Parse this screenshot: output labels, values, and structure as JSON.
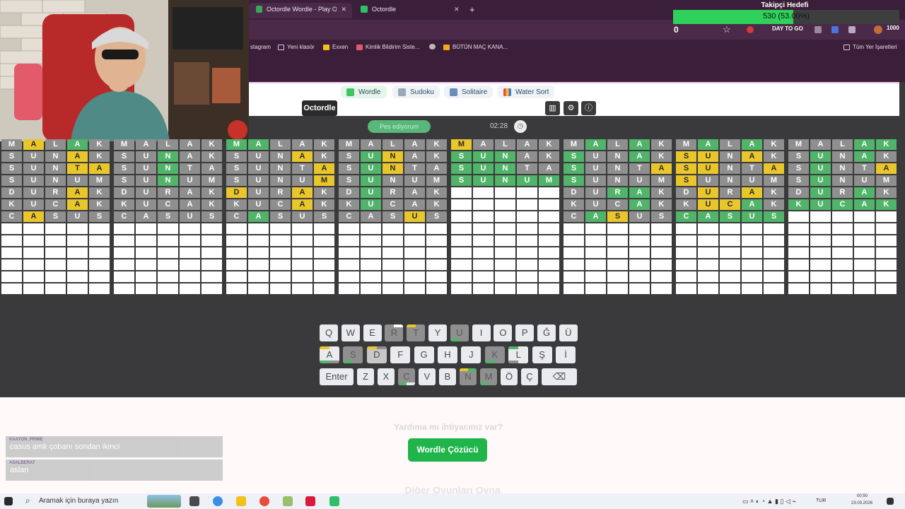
{
  "browser": {
    "tabs": [
      {
        "label": "Octordle Wordle - Play Octordl",
        "close": "✕"
      },
      {
        "label": "Octordle",
        "close": "✕"
      }
    ],
    "new_tab": "+",
    "bookmarks": [
      "stagram",
      "Yeni klasör",
      "Exxen",
      "Kimlik Bildirim Siste...",
      "BÜTÜN MAÇ KANA..."
    ],
    "all_bookmarks": "Tüm Yer İşaretleri"
  },
  "stream_overlay": {
    "title": "Takipçi Hedefi",
    "progress_text": "530 (53.00%)",
    "progress_fraction": 0.53,
    "left_value": "0",
    "right_value": "1000",
    "brand_text": "DAY TO GO"
  },
  "game_nav": [
    {
      "label": "Wordle"
    },
    {
      "label": "Sudoku"
    },
    {
      "label": "Solitaire"
    },
    {
      "label": "Water Sort"
    }
  ],
  "header": {
    "brand": "Octordle",
    "stats_icon": "stats-icon",
    "settings_icon": "gear-icon",
    "info_icon": "info-icon"
  },
  "status": {
    "give_up": "Pes ediyorum",
    "timer": "02:28"
  },
  "boards": [
    {
      "rows": [
        [
          "M",
          "A",
          "L",
          "A",
          "K"
        ],
        [
          "S",
          "U",
          "N",
          "A",
          "K"
        ],
        [
          "S",
          "U",
          "N",
          "T",
          "A"
        ],
        [
          "S",
          "U",
          "N",
          "U",
          "M"
        ],
        [
          "D",
          "U",
          "R",
          "A",
          "K"
        ],
        [
          "K",
          "U",
          "C",
          "A",
          "K"
        ],
        [
          "C",
          "A",
          "S",
          "U",
          "S"
        ]
      ],
      "states": [
        [
          "x",
          "y",
          "x",
          "g",
          "x"
        ],
        [
          "x",
          "x",
          "x",
          "y",
          "x"
        ],
        [
          "x",
          "x",
          "x",
          "y",
          "y"
        ],
        [
          "x",
          "x",
          "x",
          "x",
          "x"
        ],
        [
          "x",
          "x",
          "x",
          "y",
          "x"
        ],
        [
          "x",
          "x",
          "x",
          "y",
          "x"
        ],
        [
          "x",
          "y",
          "x",
          "x",
          "x"
        ]
      ]
    },
    {
      "rows": [
        [
          "M",
          "A",
          "L",
          "A",
          "K"
        ],
        [
          "S",
          "U",
          "N",
          "A",
          "K"
        ],
        [
          "S",
          "U",
          "N",
          "T",
          "A"
        ],
        [
          "S",
          "U",
          "N",
          "U",
          "M"
        ],
        [
          "D",
          "U",
          "R",
          "A",
          "K"
        ],
        [
          "K",
          "U",
          "C",
          "A",
          "K"
        ],
        [
          "C",
          "A",
          "S",
          "U",
          "S"
        ]
      ],
      "states": [
        [
          "x",
          "x",
          "x",
          "x",
          "x"
        ],
        [
          "x",
          "x",
          "g",
          "x",
          "x"
        ],
        [
          "x",
          "x",
          "g",
          "x",
          "x"
        ],
        [
          "x",
          "x",
          "g",
          "x",
          "x"
        ],
        [
          "x",
          "x",
          "x",
          "x",
          "x"
        ],
        [
          "x",
          "x",
          "x",
          "x",
          "x"
        ],
        [
          "x",
          "x",
          "x",
          "x",
          "x"
        ]
      ]
    },
    {
      "rows": [
        [
          "M",
          "A",
          "L",
          "A",
          "K"
        ],
        [
          "S",
          "U",
          "N",
          "A",
          "K"
        ],
        [
          "S",
          "U",
          "N",
          "T",
          "A"
        ],
        [
          "S",
          "U",
          "N",
          "U",
          "M"
        ],
        [
          "D",
          "U",
          "R",
          "A",
          "K"
        ],
        [
          "K",
          "U",
          "C",
          "A",
          "K"
        ],
        [
          "C",
          "A",
          "S",
          "U",
          "S"
        ]
      ],
      "states": [
        [
          "g",
          "g",
          "x",
          "x",
          "x"
        ],
        [
          "x",
          "x",
          "x",
          "y",
          "x"
        ],
        [
          "x",
          "x",
          "x",
          "x",
          "y"
        ],
        [
          "x",
          "x",
          "x",
          "x",
          "y"
        ],
        [
          "y",
          "x",
          "x",
          "y",
          "x"
        ],
        [
          "x",
          "x",
          "x",
          "y",
          "x"
        ],
        [
          "x",
          "g",
          "x",
          "x",
          "x"
        ]
      ]
    },
    {
      "rows": [
        [
          "M",
          "A",
          "L",
          "A",
          "K"
        ],
        [
          "S",
          "U",
          "N",
          "A",
          "K"
        ],
        [
          "S",
          "U",
          "N",
          "T",
          "A"
        ],
        [
          "S",
          "U",
          "N",
          "U",
          "M"
        ],
        [
          "D",
          "U",
          "R",
          "A",
          "K"
        ],
        [
          "K",
          "U",
          "C",
          "A",
          "K"
        ],
        [
          "C",
          "A",
          "S",
          "U",
          "S"
        ]
      ],
      "states": [
        [
          "x",
          "x",
          "x",
          "x",
          "x"
        ],
        [
          "x",
          "g",
          "y",
          "x",
          "x"
        ],
        [
          "x",
          "g",
          "y",
          "x",
          "x"
        ],
        [
          "x",
          "g",
          "x",
          "x",
          "x"
        ],
        [
          "x",
          "g",
          "x",
          "x",
          "x"
        ],
        [
          "x",
          "g",
          "x",
          "x",
          "x"
        ],
        [
          "x",
          "x",
          "x",
          "y",
          "x"
        ]
      ]
    },
    {
      "rows": [
        [
          "M",
          "A",
          "L",
          "A",
          "K"
        ],
        [
          "S",
          "U",
          "N",
          "A",
          "K"
        ],
        [
          "S",
          "U",
          "N",
          "T",
          "A"
        ],
        [
          "S",
          "U",
          "N",
          "U",
          "M"
        ]
      ],
      "states": [
        [
          "y",
          "x",
          "x",
          "x",
          "x"
        ],
        [
          "g",
          "g",
          "g",
          "x",
          "x"
        ],
        [
          "g",
          "g",
          "g",
          "x",
          "x"
        ],
        [
          "g",
          "g",
          "g",
          "g",
          "g"
        ]
      ]
    },
    {
      "rows": [
        [
          "M",
          "A",
          "L",
          "A",
          "K"
        ],
        [
          "S",
          "U",
          "N",
          "A",
          "K"
        ],
        [
          "S",
          "U",
          "N",
          "T",
          "A"
        ],
        [
          "S",
          "U",
          "N",
          "U",
          "M"
        ],
        [
          "D",
          "U",
          "R",
          "A",
          "K"
        ],
        [
          "K",
          "U",
          "C",
          "A",
          "K"
        ],
        [
          "C",
          "A",
          "S",
          "U",
          "S"
        ]
      ],
      "states": [
        [
          "x",
          "g",
          "x",
          "g",
          "x"
        ],
        [
          "g",
          "x",
          "x",
          "g",
          "x"
        ],
        [
          "g",
          "x",
          "x",
          "x",
          "y"
        ],
        [
          "g",
          "x",
          "x",
          "x",
          "x"
        ],
        [
          "x",
          "x",
          "g",
          "g",
          "x"
        ],
        [
          "x",
          "x",
          "x",
          "g",
          "x"
        ],
        [
          "x",
          "g",
          "y",
          "x",
          "x"
        ]
      ]
    },
    {
      "rows": [
        [
          "M",
          "A",
          "L",
          "A",
          "K"
        ],
        [
          "S",
          "U",
          "N",
          "A",
          "K"
        ],
        [
          "S",
          "U",
          "N",
          "T",
          "A"
        ],
        [
          "S",
          "U",
          "N",
          "U",
          "M"
        ],
        [
          "D",
          "U",
          "R",
          "A",
          "K"
        ],
        [
          "K",
          "U",
          "C",
          "A",
          "K"
        ],
        [
          "C",
          "A",
          "S",
          "U",
          "S"
        ]
      ],
      "states": [
        [
          "x",
          "g",
          "x",
          "g",
          "x"
        ],
        [
          "y",
          "y",
          "x",
          "y",
          "x"
        ],
        [
          "y",
          "y",
          "x",
          "x",
          "y"
        ],
        [
          "y",
          "x",
          "x",
          "x",
          "x"
        ],
        [
          "x",
          "y",
          "x",
          "y",
          "x"
        ],
        [
          "x",
          "y",
          "y",
          "g",
          "x"
        ],
        [
          "g",
          "g",
          "g",
          "g",
          "g"
        ]
      ]
    },
    {
      "rows": [
        [
          "M",
          "A",
          "L",
          "A",
          "K"
        ],
        [
          "S",
          "U",
          "N",
          "A",
          "K"
        ],
        [
          "S",
          "U",
          "N",
          "T",
          "A"
        ],
        [
          "S",
          "U",
          "N",
          "U",
          "M"
        ],
        [
          "D",
          "U",
          "R",
          "A",
          "K"
        ],
        [
          "K",
          "U",
          "C",
          "A",
          "K"
        ]
      ],
      "states": [
        [
          "x",
          "x",
          "x",
          "g",
          "g"
        ],
        [
          "x",
          "g",
          "x",
          "g",
          "x"
        ],
        [
          "x",
          "g",
          "x",
          "x",
          "y"
        ],
        [
          "x",
          "g",
          "x",
          "x",
          "x"
        ],
        [
          "x",
          "g",
          "x",
          "g",
          "x"
        ],
        [
          "g",
          "g",
          "g",
          "g",
          "g"
        ]
      ]
    }
  ],
  "keyboard": {
    "row1": [
      "Q",
      "W",
      "E",
      "R",
      "T",
      "Y",
      "U",
      "I",
      "O",
      "P",
      "Ğ",
      "Ü"
    ],
    "row2": [
      "A",
      "S",
      "D",
      "F",
      "G",
      "H",
      "J",
      "K",
      "L",
      "Ş",
      "İ"
    ],
    "row3": [
      "Enter",
      "Z",
      "X",
      "C",
      "V",
      "B",
      "N",
      "M",
      "Ö",
      "Ç",
      "⌫"
    ]
  },
  "help": {
    "title": "Yardıma mı ihtiyacınız var?",
    "solver_button": "Wordle Çözücü",
    "more_title": "Diğer Oyunları Oyna"
  },
  "chat": [
    {
      "user": "KAAYON_PRIME",
      "text": "casus amk çobanı sondan ikinci"
    },
    {
      "user": "ASALBERAT",
      "text": "aslan"
    }
  ],
  "taskbar": {
    "search_placeholder": "Aramak için buraya yazın",
    "lang": "TUR",
    "time": "00:50",
    "date": "23.03.2026"
  },
  "colors": {
    "correct": "#51b46a",
    "present": "#e9c62c",
    "absent": "#8f8f8f",
    "empty": "#ffffff",
    "solver": "#1fb54b"
  }
}
